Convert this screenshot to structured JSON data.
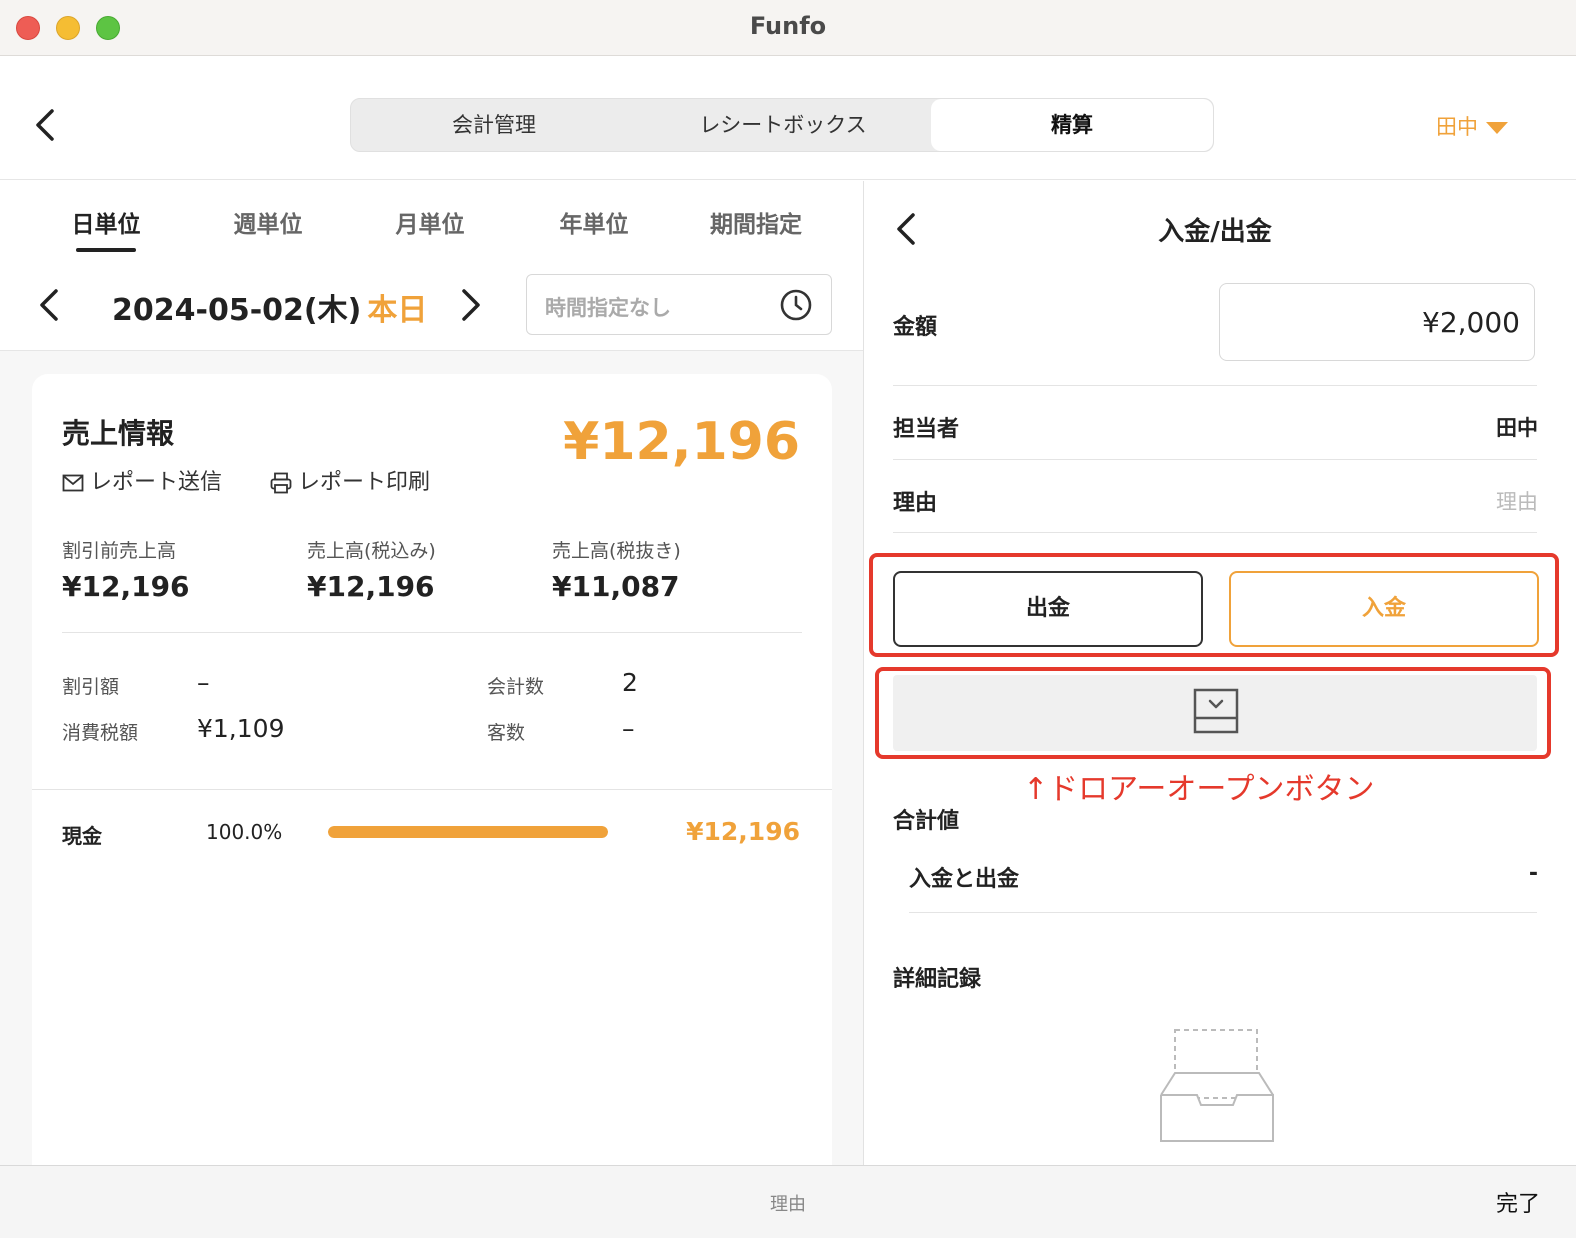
{
  "window": {
    "title": "Funfo"
  },
  "header": {
    "tabs": [
      "会計管理",
      "レシートボックス",
      "精算"
    ],
    "active_tab": "精算",
    "user": "田中"
  },
  "left": {
    "period_tabs": [
      "日単位",
      "週単位",
      "月単位",
      "年単位",
      "期間指定"
    ],
    "active_period": "日単位",
    "date": "2024-05-02(木)",
    "today_label": "本日",
    "time_placeholder": "時間指定なし",
    "card": {
      "title": "売上情報",
      "total": "¥12,196",
      "send_report": "レポート送信",
      "print_report": "レポート印刷",
      "metrics": [
        {
          "label": "割引前売上高",
          "value": "¥12,196"
        },
        {
          "label": "売上高(税込み)",
          "value": "¥12,196"
        },
        {
          "label": "売上高(税抜き)",
          "value": "¥11,087"
        }
      ],
      "discount_label": "割引額",
      "discount_value": "–",
      "tax_label": "消費税額",
      "tax_value": "¥1,109",
      "count_label": "会計数",
      "count_value": "2",
      "customers_label": "客数",
      "customers_value": "–",
      "payment": {
        "label": "現金",
        "percent": "100.0%",
        "fraction": 1.0,
        "amount": "¥12,196"
      }
    }
  },
  "right": {
    "title": "入金/出金",
    "amount_label": "金額",
    "amount_value": "¥2,000",
    "staff_label": "担当者",
    "staff_value": "田中",
    "reason_label": "理由",
    "reason_placeholder": "理由",
    "withdraw_label": "出金",
    "deposit_label": "入金",
    "annotation": "↑ドロアーオープンボタン",
    "total_heading": "合計値",
    "sum_label": "入金と出金",
    "sum_value": "-",
    "detail_heading": "詳細記録"
  },
  "bottombar": {
    "placeholder": "理由",
    "done": "完了"
  },
  "colors": {
    "accent": "#f0a23a",
    "annotation": "#e5392c"
  }
}
